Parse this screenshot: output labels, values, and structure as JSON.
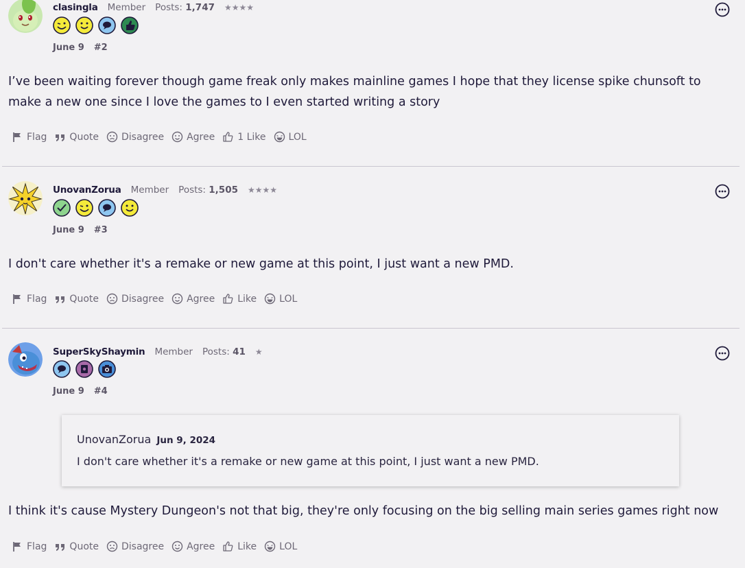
{
  "colors": {
    "background": "#f2f1f3",
    "text": "#1f1a3a",
    "muted": "#6d6876",
    "separator": "#c9c6cf"
  },
  "posts": [
    {
      "username": "clasingla",
      "role": "Member",
      "posts_label": "Posts:",
      "posts_count": "1,747",
      "stars": "★★★★",
      "badges": [
        "wink-face-badge-icon",
        "smile-face-badge-icon",
        "speech-bubble-badge-icon",
        "thumbs-up-badge-icon"
      ],
      "date": "June 9",
      "number": "#2",
      "text": "I’ve been waiting forever though game freak only makes mainline games I hope that they license spike chunsoft to make a new one since I love the games to I even started writing a story",
      "actions": {
        "flag": "Flag",
        "quote": "Quote",
        "disagree": "Disagree",
        "agree": "Agree",
        "like": "1 Like",
        "lol": "LOL"
      }
    },
    {
      "username": "UnovanZorua",
      "role": "Member",
      "posts_label": "Posts:",
      "posts_count": "1,505",
      "stars": "★★★★",
      "badges": [
        "checkmark-badge-icon",
        "wink-face-badge-icon",
        "speech-bubble-badge-icon",
        "smile-face-badge-icon"
      ],
      "date": "June 9",
      "number": "#3",
      "text": "I don't care whether it's a remake or new game at this point, I just want a new PMD.",
      "actions": {
        "flag": "Flag",
        "quote": "Quote",
        "disagree": "Disagree",
        "agree": "Agree",
        "like": "Like",
        "lol": "LOL"
      }
    },
    {
      "username": "SuperSkyShaymin",
      "role": "Member",
      "posts_label": "Posts:",
      "posts_count": "41",
      "stars": "★",
      "badges": [
        "speech-bubble-badge-icon",
        "settings-badge-icon",
        "camera-badge-icon"
      ],
      "date": "June 9",
      "number": "#4",
      "quote": {
        "author": "UnovanZorua",
        "date": "Jun 9, 2024",
        "text": "I don't care whether it's a remake or new game at this point, I just want a new PMD."
      },
      "text": "I think it's cause Mystery Dungeon's not that big, they're only focusing on the big selling main series games right now",
      "actions": {
        "flag": "Flag",
        "quote": "Quote",
        "disagree": "Disagree",
        "agree": "Agree",
        "like": "Like",
        "lol": "LOL"
      }
    }
  ]
}
